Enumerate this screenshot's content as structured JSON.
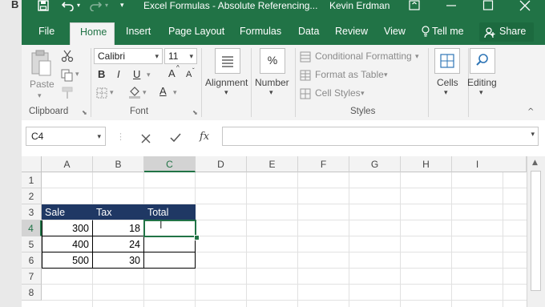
{
  "window": {
    "title": "Excel Formulas - Absolute Referencing...",
    "user": "Kevin Erdman",
    "background_letter": "B"
  },
  "ribbon_tabs": [
    "File",
    "Home",
    "Insert",
    "Page Layout",
    "Formulas",
    "Data",
    "Review",
    "View"
  ],
  "tell_me": "Tell me",
  "share": "Share",
  "clipboard": {
    "paste": "Paste",
    "label": "Clipboard"
  },
  "font": {
    "name": "Calibri",
    "size": "11",
    "label": "Font",
    "bold": "B",
    "italic": "I",
    "underline": "U",
    "grow": "A",
    "shrink": "A",
    "color": "A"
  },
  "alignment": {
    "label": "Alignment"
  },
  "number": {
    "label": "Number",
    "icon_text": "%"
  },
  "styles": {
    "conditional": "Conditional Formatting",
    "format_table": "Format as Table",
    "cell_styles": "Cell Styles",
    "label": "Styles"
  },
  "cells": {
    "label": "Cells"
  },
  "editing": {
    "label": "Editing"
  },
  "formula_bar": {
    "name_box": "C4",
    "fx": "fx",
    "formula": ""
  },
  "sheet": {
    "columns": [
      "A",
      "B",
      "C",
      "D",
      "E",
      "F",
      "G",
      "H",
      "I"
    ],
    "rows": [
      "1",
      "2",
      "3",
      "4",
      "5",
      "6",
      "7",
      "8"
    ],
    "table": {
      "headers": [
        "Sale",
        "Tax",
        "Total"
      ],
      "rows": [
        [
          "300",
          "18",
          ""
        ],
        [
          "400",
          "24",
          ""
        ],
        [
          "500",
          "30",
          ""
        ]
      ]
    },
    "selected_cell": "C4"
  },
  "colors": {
    "excel_green": "#217346",
    "header_fill": "#1f3864",
    "selection": "#217346"
  }
}
